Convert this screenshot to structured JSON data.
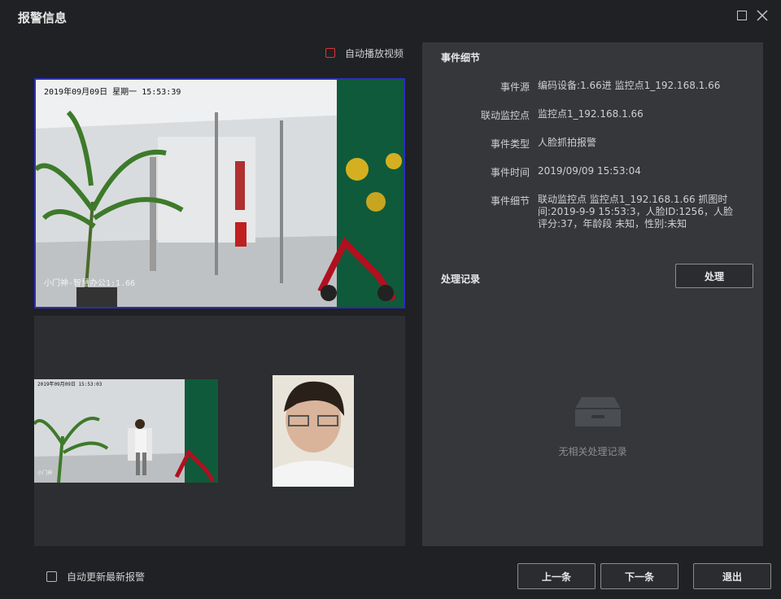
{
  "window": {
    "title": "报警信息"
  },
  "autoplay": {
    "label": "自动播放视频",
    "checked": false
  },
  "video": {
    "timestamp": "2019年09月09日  星期一  15:53:39",
    "channel": "小门神-智慧办公1:1.66"
  },
  "thumbs": {
    "scene_timestamp": "2019年09月09日 15:53:03",
    "scene_channel": "小门神"
  },
  "details": {
    "title": "事件细节",
    "rows": [
      {
        "label": "事件源",
        "value": "编码设备:1.66进 监控点1_192.168.1.66"
      },
      {
        "label": "联动监控点",
        "value": "监控点1_192.168.1.66"
      },
      {
        "label": "事件类型",
        "value": "人脸抓拍报警"
      },
      {
        "label": "事件时间",
        "value": "2019/09/09 15:53:04"
      },
      {
        "label": "事件细节",
        "value": "联动监控点 监控点1_192.168.1.66 抓图时间:2019-9-9 15:53:3，人脸ID:1256，人脸评分:37，年龄段 未知，性别:未知"
      }
    ]
  },
  "records": {
    "title": "处理记录",
    "process_label": "处理",
    "empty_text": "无相关处理记录"
  },
  "footer": {
    "auto_update_label": "自动更新最新报警",
    "prev_label": "上一条",
    "next_label": "下一条",
    "exit_label": "退出"
  }
}
